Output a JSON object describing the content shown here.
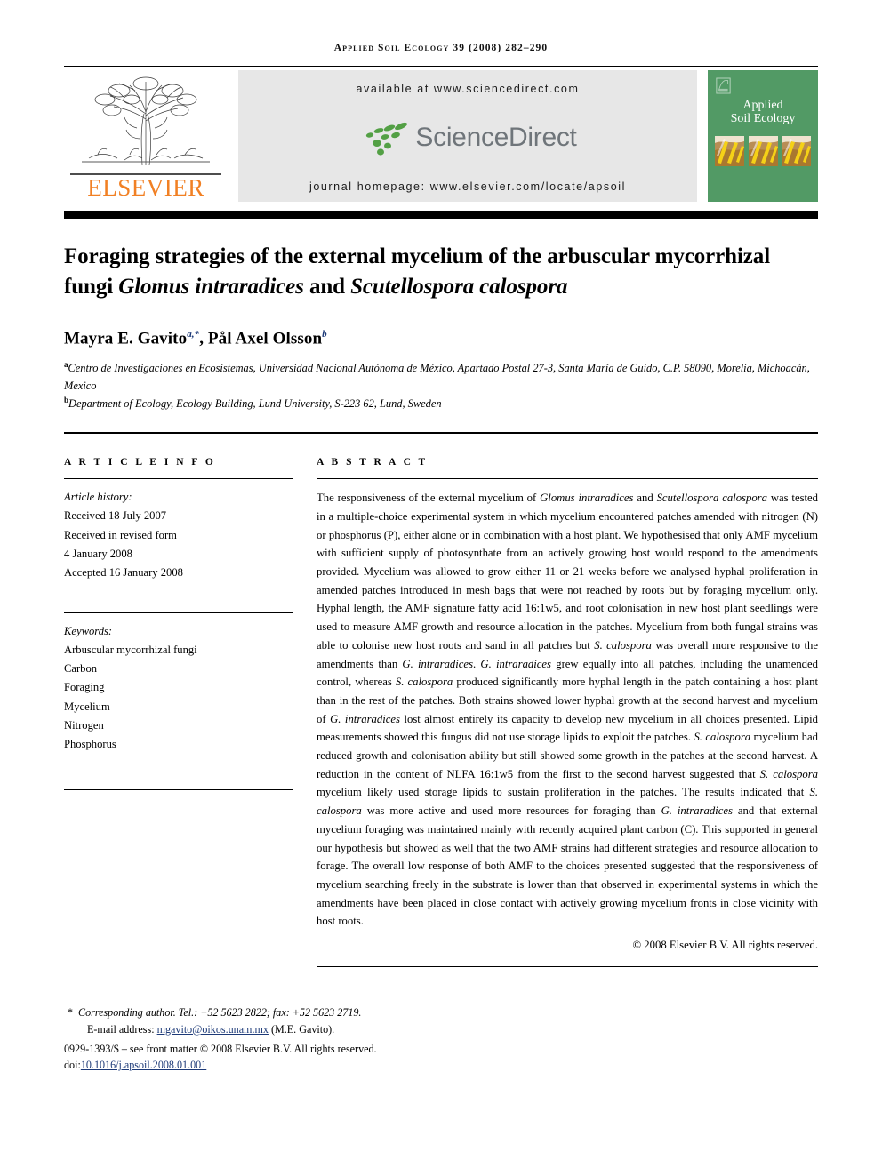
{
  "running_head": "Applied Soil Ecology 39 (2008) 282–290",
  "masthead": {
    "publisher_name": "ELSEVIER",
    "publisher_logo_icon": "elsevier-tree-icon",
    "available_at": "available at www.sciencedirect.com",
    "sciencedirect_wordmark": "ScienceDirect",
    "sciencedirect_logo_icon": "sciencedirect-leaf-dots-icon",
    "journal_homepage": "journal homepage: www.elsevier.com/locate/apsoil",
    "cover": {
      "title_line1": "Applied",
      "title_line2": "Soil Ecology",
      "logo_icon": "elsevier-mark-icon",
      "art_icon": "soil-profile-icon",
      "background_color": "#529a65"
    },
    "colors": {
      "elsevier_orange": "#f18024",
      "sciencedirect_grey": "#6f757a",
      "banner_grey": "#e7e7e6"
    }
  },
  "article": {
    "title_html": "Foraging strategies of the external mycelium of the arbuscular mycorrhizal fungi <i>Glomus intraradices</i> and <i>Scutellospora calospora</i>",
    "title_plain": "Foraging strategies of the external mycelium of the arbuscular mycorrhizal fungi Glomus intraradices and Scutellospora calospora",
    "authors_html": "Mayra E. Gavito<sup>a,*</sup>, Pål Axel Olsson<sup>b</sup>",
    "affiliations": [
      {
        "marker": "a",
        "text": "Centro de Investigaciones en Ecosistemas, Universidad Nacional Autónoma de México, Apartado Postal 27-3, Santa María de Guido, C.P. 58090, Morelia, Michoacán, Mexico"
      },
      {
        "marker": "b",
        "text": "Department of Ecology, Ecology Building, Lund University, S-223 62, Lund, Sweden"
      }
    ]
  },
  "article_info": {
    "heading": "A R T I C L E   I N F O",
    "history_label": "Article history:",
    "history_lines": [
      "Received 18 July 2007",
      "Received in revised form",
      "4 January 2008",
      "Accepted 16 January 2008"
    ],
    "keywords_label": "Keywords:",
    "keywords": [
      "Arbuscular mycorrhizal fungi",
      "Carbon",
      "Foraging",
      "Mycelium",
      "Nitrogen",
      "Phosphorus"
    ]
  },
  "abstract": {
    "heading": "A B S T R A C T",
    "text_html": "The responsiveness of the external mycelium of <i>Glomus intraradices</i> and <i>Scutellospora calospora</i> was tested in a multiple-choice experimental system in which mycelium encountered patches amended with nitrogen (N) or phosphorus (P), either alone or in combination with a host plant. We hypothesised that only AMF mycelium with sufficient supply of photosynthate from an actively growing host would respond to the amendments provided. Mycelium was allowed to grow either 11 or 21 weeks before we analysed hyphal proliferation in amended patches introduced in mesh bags that were not reached by roots but by foraging mycelium only. Hyphal length, the AMF signature fatty acid 16:1w5, and root colonisation in new host plant seedlings were used to measure AMF growth and resource allocation in the patches. Mycelium from both fungal strains was able to colonise new host roots and sand in all patches but <i>S. calospora</i> was overall more responsive to the amendments than <i>G. intraradices</i>. <i>G. intraradices</i> grew equally into all patches, including the unamended control, whereas <i>S. calospora</i> produced significantly more hyphal length in the patch containing a host plant than in the rest of the patches. Both strains showed lower hyphal growth at the second harvest and mycelium of <i>G. intraradices</i> lost almost entirely its capacity to develop new mycelium in all choices presented. Lipid measurements showed this fungus did not use storage lipids to exploit the patches. <i>S. calospora</i> mycelium had reduced growth and colonisation ability but still showed some growth in the patches at the second harvest. A reduction in the content of NLFA 16:1w5 from the first to the second harvest suggested that <i>S. calospora</i> mycelium likely used storage lipids to sustain proliferation in the patches. The results indicated that <i>S. calospora</i> was more active and used more resources for foraging than <i>G. intraradices</i> and that external mycelium foraging was maintained mainly with recently acquired plant carbon (C). This supported in general our hypothesis but showed as well that the two AMF strains had different strategies and resource allocation to forage. The overall low response of both AMF to the choices presented suggested that the responsiveness of mycelium searching freely in the substrate is lower than that observed in experimental systems in which the amendments have been placed in close contact with actively growing mycelium fronts in close vicinity with host roots.",
    "copyright": "© 2008 Elsevier B.V. All rights reserved."
  },
  "footnotes": {
    "corresponding_marker": "*",
    "corresponding_text": "Corresponding author. Tel.: +52 5623 2822; fax: +52 5623 2719.",
    "email_label": "E-mail address:",
    "email_address": "mgavito@oikos.unam.mx",
    "email_attribution": "(M.E. Gavito).",
    "issn_line": "0929-1393/$ – see front matter © 2008 Elsevier B.V. All rights reserved.",
    "doi_prefix": "doi:",
    "doi_value": "10.1016/j.apsoil.2008.01.001",
    "link_color": "#1d3a78"
  }
}
